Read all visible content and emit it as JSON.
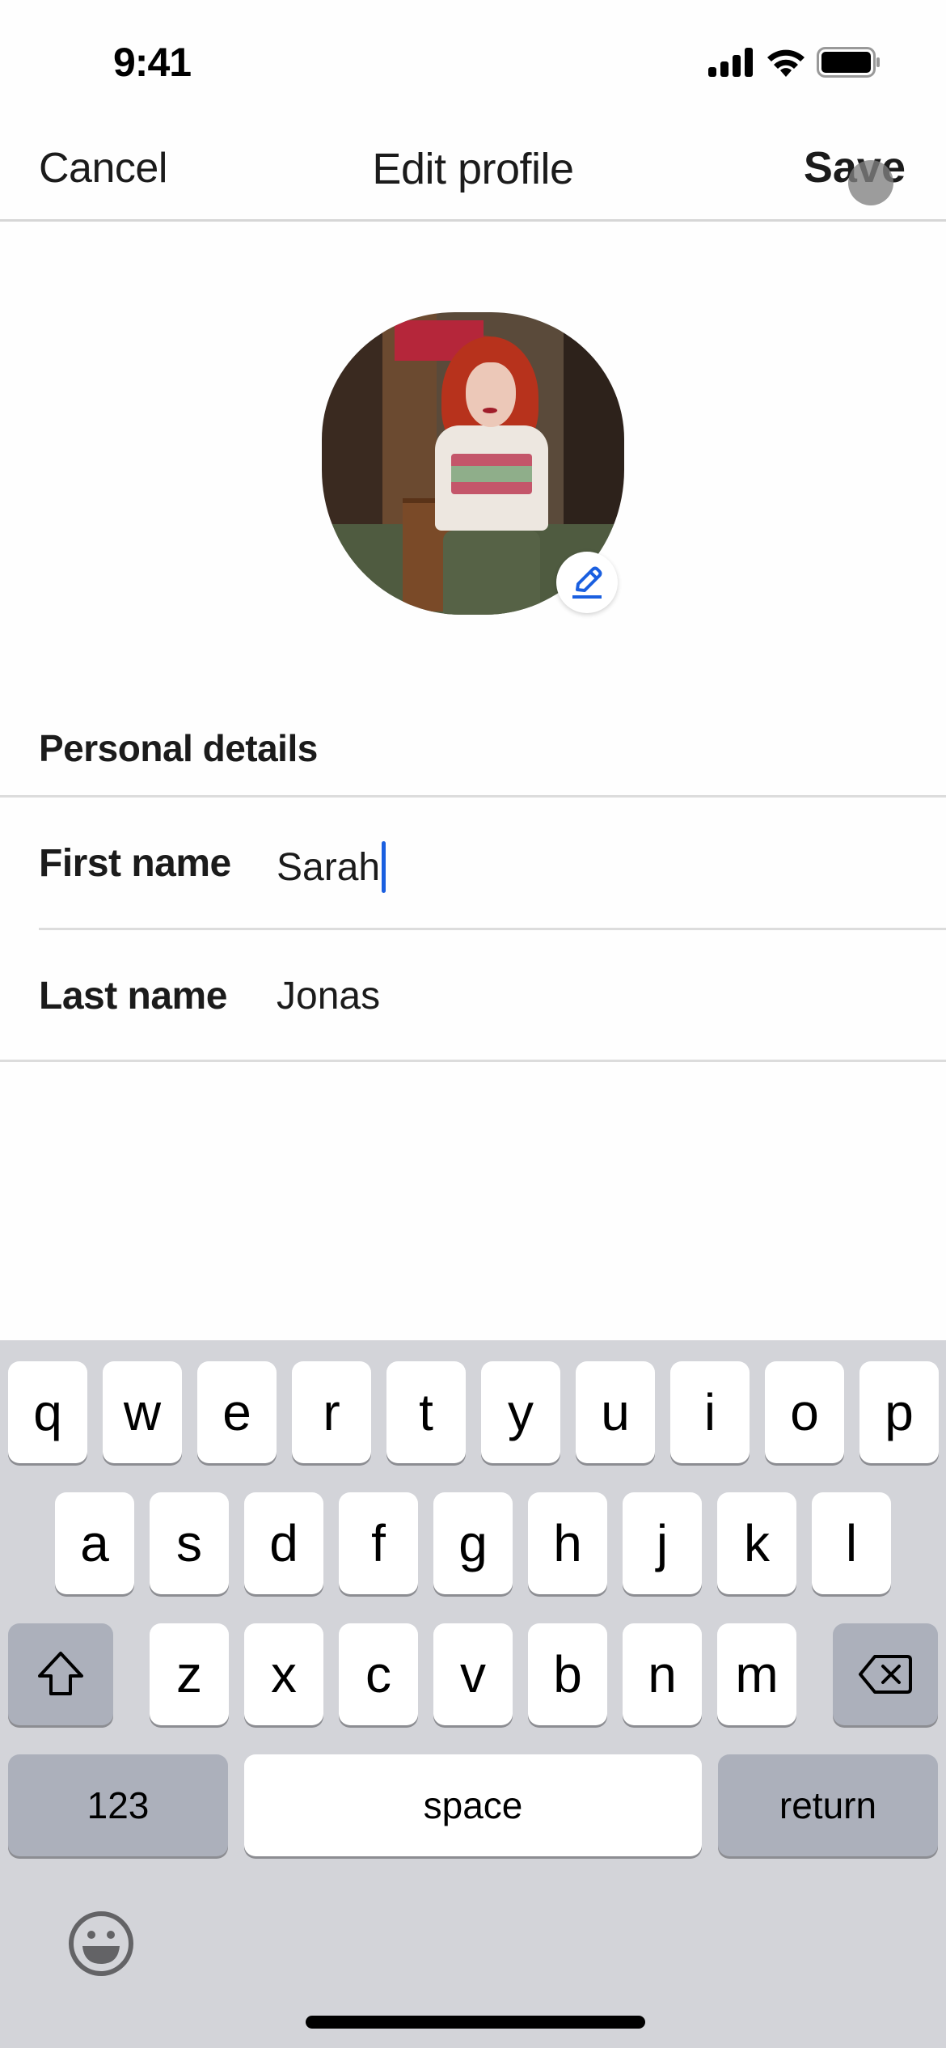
{
  "status_bar": {
    "time": "9:41",
    "icons": [
      "cellular-signal-icon",
      "wifi-icon",
      "battery-icon"
    ]
  },
  "nav": {
    "cancel_label": "Cancel",
    "title": "Edit profile",
    "save_label": "Save"
  },
  "profile": {
    "avatar_alt": "Profile photo of a woman with red curly hair in a barbershop",
    "edit_icon": "pencil-icon"
  },
  "section": {
    "title": "Personal details",
    "fields": [
      {
        "label": "First name",
        "value": "Sarah",
        "focused": true
      },
      {
        "label": "Last name",
        "value": "Jonas",
        "focused": false
      }
    ]
  },
  "keyboard": {
    "row1": [
      "q",
      "w",
      "e",
      "r",
      "t",
      "y",
      "u",
      "i",
      "o",
      "p"
    ],
    "row2": [
      "a",
      "s",
      "d",
      "f",
      "g",
      "h",
      "j",
      "k",
      "l"
    ],
    "row3": [
      "z",
      "x",
      "c",
      "v",
      "b",
      "n",
      "m"
    ],
    "shift_icon": "shift-icon",
    "delete_icon": "backspace-icon",
    "numbers_label": "123",
    "space_label": "space",
    "return_label": "return",
    "emoji_icon": "emoji-icon"
  },
  "colors": {
    "accent": "#1a5fe0",
    "keyboard_bg": "#d3d4d9",
    "key_dark": "#acb0bb"
  }
}
